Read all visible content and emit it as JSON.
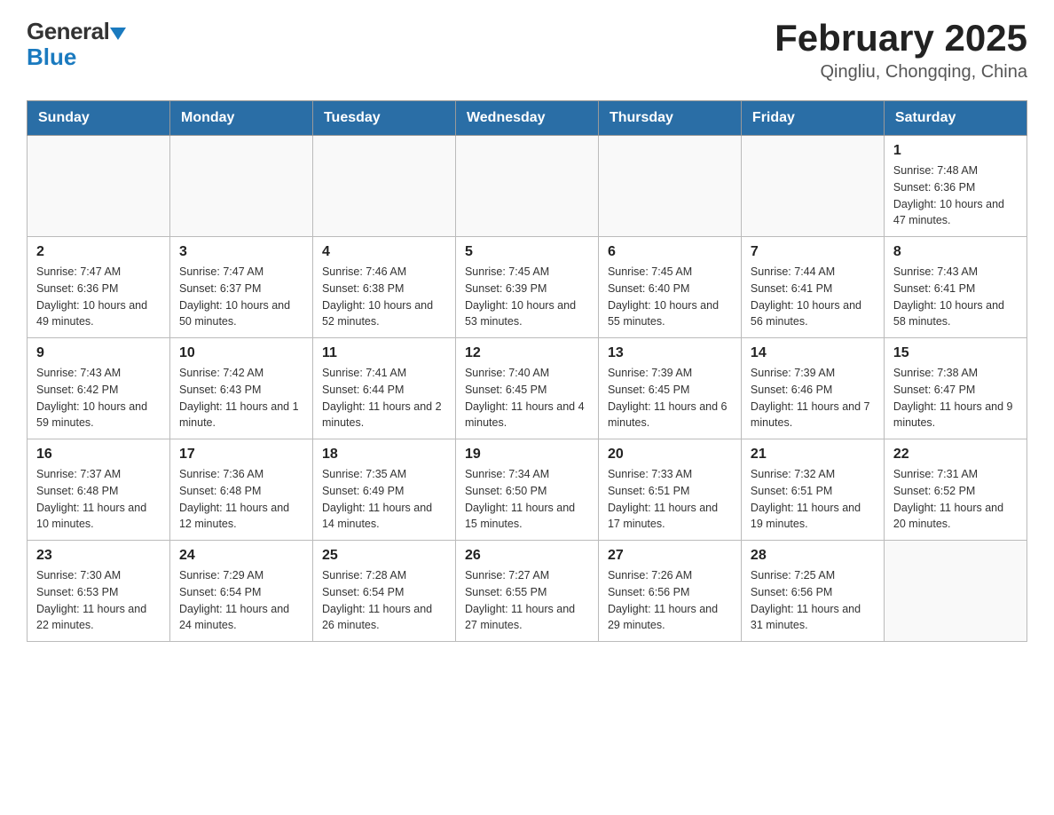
{
  "header": {
    "logo_general": "General",
    "logo_blue": "Blue",
    "month_title": "February 2025",
    "location": "Qingliu, Chongqing, China"
  },
  "calendar": {
    "days_of_week": [
      "Sunday",
      "Monday",
      "Tuesday",
      "Wednesday",
      "Thursday",
      "Friday",
      "Saturday"
    ],
    "weeks": [
      [
        {
          "day": "",
          "info": ""
        },
        {
          "day": "",
          "info": ""
        },
        {
          "day": "",
          "info": ""
        },
        {
          "day": "",
          "info": ""
        },
        {
          "day": "",
          "info": ""
        },
        {
          "day": "",
          "info": ""
        },
        {
          "day": "1",
          "info": "Sunrise: 7:48 AM\nSunset: 6:36 PM\nDaylight: 10 hours and 47 minutes."
        }
      ],
      [
        {
          "day": "2",
          "info": "Sunrise: 7:47 AM\nSunset: 6:36 PM\nDaylight: 10 hours and 49 minutes."
        },
        {
          "day": "3",
          "info": "Sunrise: 7:47 AM\nSunset: 6:37 PM\nDaylight: 10 hours and 50 minutes."
        },
        {
          "day": "4",
          "info": "Sunrise: 7:46 AM\nSunset: 6:38 PM\nDaylight: 10 hours and 52 minutes."
        },
        {
          "day": "5",
          "info": "Sunrise: 7:45 AM\nSunset: 6:39 PM\nDaylight: 10 hours and 53 minutes."
        },
        {
          "day": "6",
          "info": "Sunrise: 7:45 AM\nSunset: 6:40 PM\nDaylight: 10 hours and 55 minutes."
        },
        {
          "day": "7",
          "info": "Sunrise: 7:44 AM\nSunset: 6:41 PM\nDaylight: 10 hours and 56 minutes."
        },
        {
          "day": "8",
          "info": "Sunrise: 7:43 AM\nSunset: 6:41 PM\nDaylight: 10 hours and 58 minutes."
        }
      ],
      [
        {
          "day": "9",
          "info": "Sunrise: 7:43 AM\nSunset: 6:42 PM\nDaylight: 10 hours and 59 minutes."
        },
        {
          "day": "10",
          "info": "Sunrise: 7:42 AM\nSunset: 6:43 PM\nDaylight: 11 hours and 1 minute."
        },
        {
          "day": "11",
          "info": "Sunrise: 7:41 AM\nSunset: 6:44 PM\nDaylight: 11 hours and 2 minutes."
        },
        {
          "day": "12",
          "info": "Sunrise: 7:40 AM\nSunset: 6:45 PM\nDaylight: 11 hours and 4 minutes."
        },
        {
          "day": "13",
          "info": "Sunrise: 7:39 AM\nSunset: 6:45 PM\nDaylight: 11 hours and 6 minutes."
        },
        {
          "day": "14",
          "info": "Sunrise: 7:39 AM\nSunset: 6:46 PM\nDaylight: 11 hours and 7 minutes."
        },
        {
          "day": "15",
          "info": "Sunrise: 7:38 AM\nSunset: 6:47 PM\nDaylight: 11 hours and 9 minutes."
        }
      ],
      [
        {
          "day": "16",
          "info": "Sunrise: 7:37 AM\nSunset: 6:48 PM\nDaylight: 11 hours and 10 minutes."
        },
        {
          "day": "17",
          "info": "Sunrise: 7:36 AM\nSunset: 6:48 PM\nDaylight: 11 hours and 12 minutes."
        },
        {
          "day": "18",
          "info": "Sunrise: 7:35 AM\nSunset: 6:49 PM\nDaylight: 11 hours and 14 minutes."
        },
        {
          "day": "19",
          "info": "Sunrise: 7:34 AM\nSunset: 6:50 PM\nDaylight: 11 hours and 15 minutes."
        },
        {
          "day": "20",
          "info": "Sunrise: 7:33 AM\nSunset: 6:51 PM\nDaylight: 11 hours and 17 minutes."
        },
        {
          "day": "21",
          "info": "Sunrise: 7:32 AM\nSunset: 6:51 PM\nDaylight: 11 hours and 19 minutes."
        },
        {
          "day": "22",
          "info": "Sunrise: 7:31 AM\nSunset: 6:52 PM\nDaylight: 11 hours and 20 minutes."
        }
      ],
      [
        {
          "day": "23",
          "info": "Sunrise: 7:30 AM\nSunset: 6:53 PM\nDaylight: 11 hours and 22 minutes."
        },
        {
          "day": "24",
          "info": "Sunrise: 7:29 AM\nSunset: 6:54 PM\nDaylight: 11 hours and 24 minutes."
        },
        {
          "day": "25",
          "info": "Sunrise: 7:28 AM\nSunset: 6:54 PM\nDaylight: 11 hours and 26 minutes."
        },
        {
          "day": "26",
          "info": "Sunrise: 7:27 AM\nSunset: 6:55 PM\nDaylight: 11 hours and 27 minutes."
        },
        {
          "day": "27",
          "info": "Sunrise: 7:26 AM\nSunset: 6:56 PM\nDaylight: 11 hours and 29 minutes."
        },
        {
          "day": "28",
          "info": "Sunrise: 7:25 AM\nSunset: 6:56 PM\nDaylight: 11 hours and 31 minutes."
        },
        {
          "day": "",
          "info": ""
        }
      ]
    ]
  }
}
